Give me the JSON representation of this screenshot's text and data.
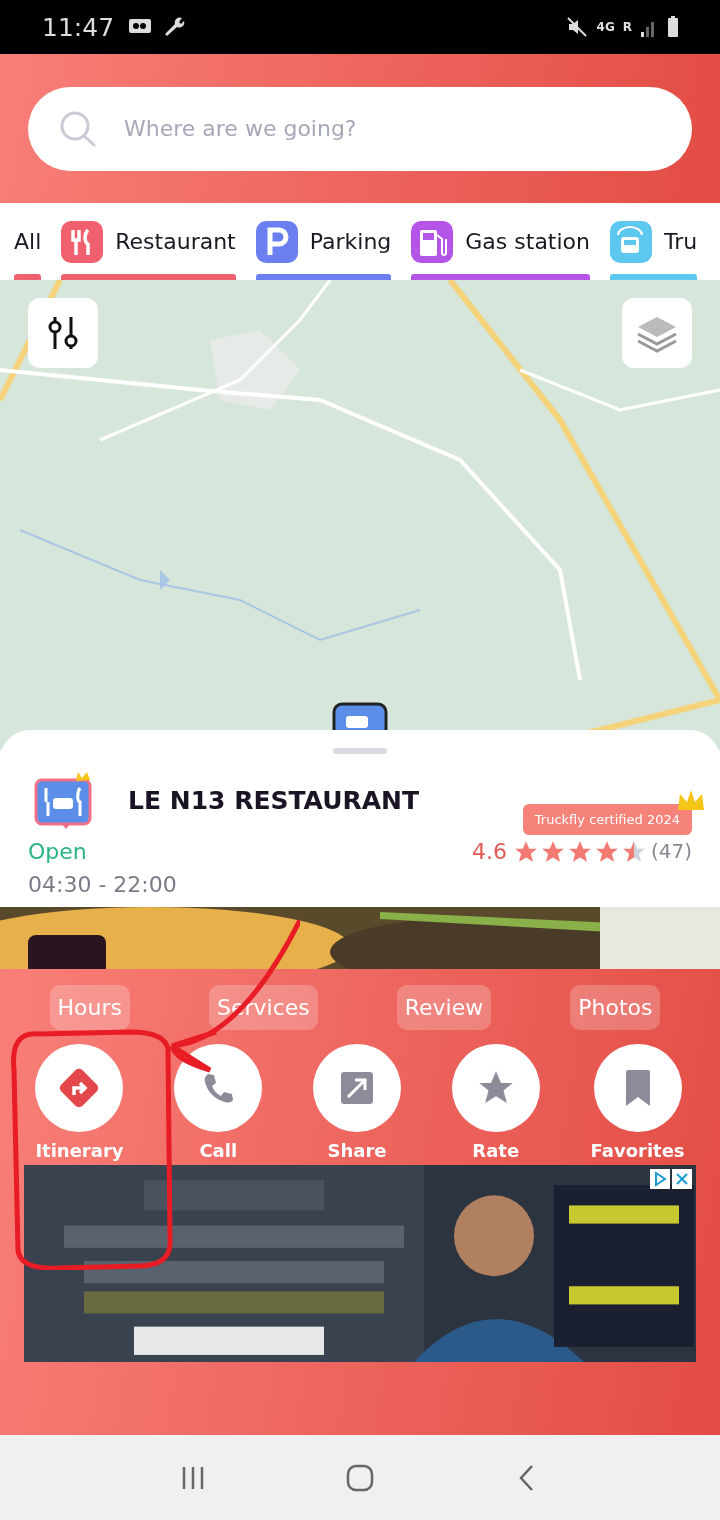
{
  "status_bar": {
    "time": "11:47",
    "network": "4G",
    "roaming": "R"
  },
  "search": {
    "placeholder": "Where are we going?"
  },
  "categories": [
    {
      "label": "All",
      "kind": "plain",
      "color": "#f0606e"
    },
    {
      "label": "Restaurant",
      "kind": "restaurant",
      "color": "#f0606e"
    },
    {
      "label": "Parking",
      "kind": "parking",
      "color": "#6a7ff0"
    },
    {
      "label": "Gas station",
      "kind": "gas",
      "color": "#b455e8"
    },
    {
      "label": "Tru",
      "kind": "truck",
      "color": "#5cc8f0"
    }
  ],
  "place": {
    "name": "LE N13 RESTAURANT",
    "badge": "Truckfly certified 2024",
    "status": "Open",
    "hours": "04:30 - 22:00",
    "rating": "4.6",
    "stars": 4.5,
    "reviews": "(47)"
  },
  "sections": [
    "Hours",
    "Services",
    "Review",
    "Photos"
  ],
  "actions": [
    {
      "label": "Itinerary",
      "kind": "itinerary"
    },
    {
      "label": "Call",
      "kind": "call"
    },
    {
      "label": "Share",
      "kind": "share"
    },
    {
      "label": "Rate",
      "kind": "rate"
    },
    {
      "label": "Favorites",
      "kind": "favorite"
    }
  ]
}
